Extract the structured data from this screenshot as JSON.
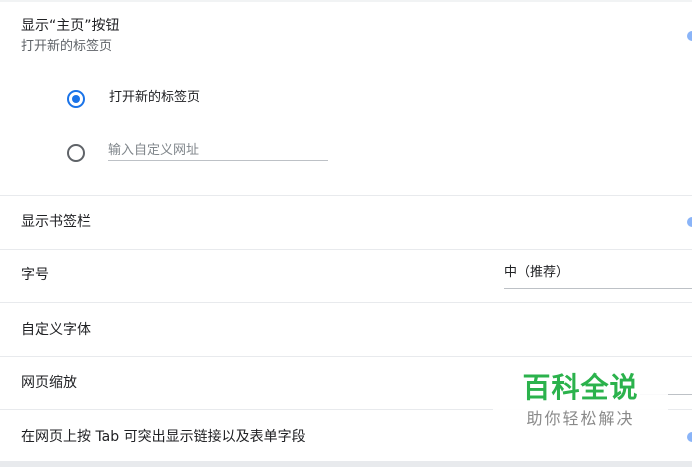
{
  "home_button": {
    "title": "显示“主页”按钮",
    "subtitle": "打开新的标签页",
    "option_new_tab": "打开新的标签页",
    "custom_url_placeholder": "输入自定义网址",
    "custom_url_value": "",
    "selected_option": "new_tab"
  },
  "settings_rows": {
    "bookmarks_bar": "显示书签栏",
    "font_size": "字号",
    "font_size_value": "中（推荐）",
    "custom_fonts": "自定义字体",
    "page_zoom": "网页缩放",
    "tab_highlight": "在网页上按 Tab 可突出显示链接以及表单字段"
  },
  "watermark": {
    "title": "百科全说",
    "subtitle": "助你轻松解决"
  },
  "colors": {
    "accent": "#1a73e8",
    "toggle_accent": "#8ab4f8",
    "watermark_green": "#2bb24c"
  }
}
